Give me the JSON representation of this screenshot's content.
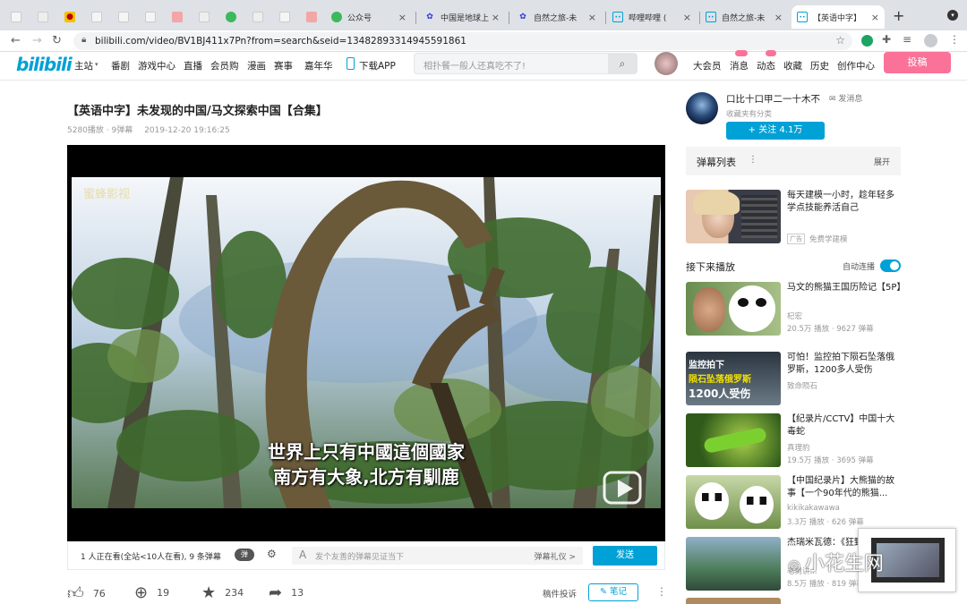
{
  "browser": {
    "tabs": [
      {
        "label": "",
        "icon": "page-icon"
      },
      {
        "label": "",
        "icon": "page-icon"
      },
      {
        "label": "",
        "icon": "cartoon-icon"
      },
      {
        "label": "",
        "icon": "page-icon"
      },
      {
        "label": "",
        "icon": "page-icon"
      },
      {
        "label": "",
        "icon": "page-icon"
      },
      {
        "label": "",
        "icon": "red-icon"
      },
      {
        "label": "",
        "icon": "page-icon"
      },
      {
        "label": "",
        "icon": "green-icon"
      },
      {
        "label": "",
        "icon": "page-icon"
      },
      {
        "label": "",
        "icon": "page-icon"
      },
      {
        "label": "",
        "icon": "red-icon"
      },
      {
        "label": "公众号",
        "icon": "wechat-icon"
      },
      {
        "label": "中国是地球上",
        "icon": "baidu-paw-icon"
      },
      {
        "label": "自然之旅-未",
        "icon": "baidu-paw-icon"
      },
      {
        "label": "哔哩哔哩 (",
        "icon": "bilibili-tv-icon"
      },
      {
        "label": "自然之旅-未",
        "icon": "bilibili-tv-icon"
      },
      {
        "label": "【英语中字】",
        "icon": "bilibili-tv-icon"
      }
    ],
    "new_tab": "+",
    "url": "bilibili.com/video/BV1BJ411x7Pn?from=search&seid=13482893314945591861"
  },
  "header": {
    "logo": "bilibili",
    "nav": [
      "主站",
      "番剧",
      "游戏中心",
      "直播",
      "会员购",
      "漫画",
      "赛事",
      "嘉年华",
      "下载APP"
    ],
    "search_placeholder": "相扑餐一般人还真吃不了!",
    "right": [
      "大会员",
      "消息",
      "动态",
      "收藏",
      "历史",
      "创作中心"
    ],
    "upload": "投稿"
  },
  "video": {
    "title": "【英语中字】未发现的中国/马文探索中国【合集】",
    "views": "5280播放",
    "danmaku": "9弹幕",
    "date": "2019-12-20 19:16:25",
    "subtitle_line1": "世界上只有中國這個國家",
    "subtitle_line2": "南方有大象,北方有馴鹿",
    "watermark": "蜜蜂影视"
  },
  "controls": {
    "watching": "1 人正在看(全站<10人在看), 9 条弹幕",
    "danmu_toggle": "弹",
    "input_placeholder": "发个友善的弹幕见证当下",
    "etiquette": "弹幕礼仪 >",
    "send": "发送"
  },
  "actions": {
    "likes": "76",
    "coins": "19",
    "favorites": "234",
    "shares": "13",
    "report": "稿件投诉",
    "notes": "笔记"
  },
  "uploader": {
    "name": "口比十口甲二一十木不",
    "message": "发消息",
    "desc": "收藏夹有分类",
    "follow": "+ 关注 4.1万"
  },
  "sidebar": {
    "danmaku_list": "弹幕列表",
    "expand": "展开",
    "ad": {
      "title": "每天建模一小时，趁年轻多学点技能养活自己",
      "tag": "广告",
      "author": "免费学建模"
    },
    "next_heading": "接下来播放",
    "autoplay": "自动连播",
    "items": [
      {
        "title": "马文的熊猫王国历险记【5P】",
        "author": "杞宏",
        "stats": "20.5万 播放 · 9627 弹幕"
      },
      {
        "title": "可怕！监控拍下陨石坠落俄罗斯，1200多人受伤",
        "author": "致命陨石",
        "stats": "",
        "thumb_text1": "监控拍下",
        "thumb_text2": "陨石坠落俄罗斯",
        "thumb_text3": "1200人受伤"
      },
      {
        "title": "【纪录片/CCTV】中国十大毒蛇",
        "author": "真理豹",
        "stats": "19.5万 播放 · 3695 弹幕"
      },
      {
        "title": "【中国纪录片】大熊猫的故事【一个90年代的熊猫...",
        "author": "kikikakawawa",
        "stats": "3.3万 播放 · 626 弹幕"
      },
      {
        "title": "杰瑞米瓦德：《狂野...",
        "author": "老舅讲...",
        "stats": "8.5万 播放 · 819 弹幕"
      }
    ]
  },
  "overlay": {
    "watermark": "小花生网"
  },
  "colors": {
    "bilibili_blue": "#00a1d6",
    "bilibili_pink": "#fb7299"
  }
}
